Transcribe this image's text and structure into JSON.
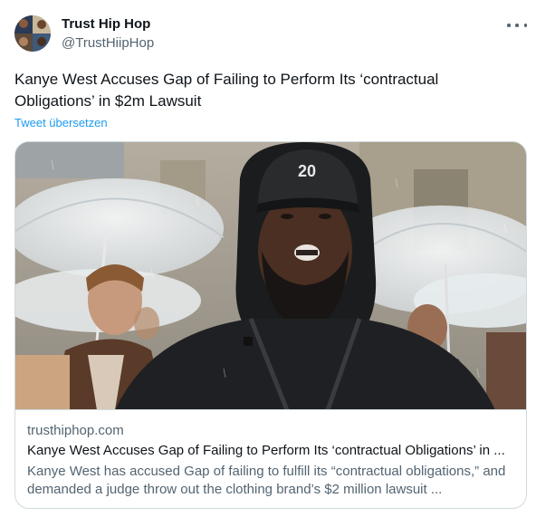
{
  "author": {
    "display_name": "Trust Hip Hop",
    "handle": "@TrustHiipHop",
    "avatar_icon": "avatar-collage"
  },
  "menu_icon": "more-horizontal-icon",
  "tweet": {
    "text": "Kanye West Accuses Gap of Failing to Perform Its ‘contractual Obligations’ in $2m Lawsuit",
    "translate_label": "Tweet übersetzen"
  },
  "link_card": {
    "image_icon": "article-photo",
    "cap_text": "20",
    "domain": "trusthiphop.com",
    "title": "Kanye West Accuses Gap of Failing to Perform Its ‘contractual Obligations’ in ...",
    "description": "Kanye West has accused Gap of failing to fulfill its “contractual obligations,” and demanded a judge throw out the clothing brand’s $2 million lawsuit ..."
  },
  "colors": {
    "text_primary": "#0f1419",
    "text_secondary": "#536471",
    "link": "#1d9bf0",
    "border": "#cfd9de"
  }
}
